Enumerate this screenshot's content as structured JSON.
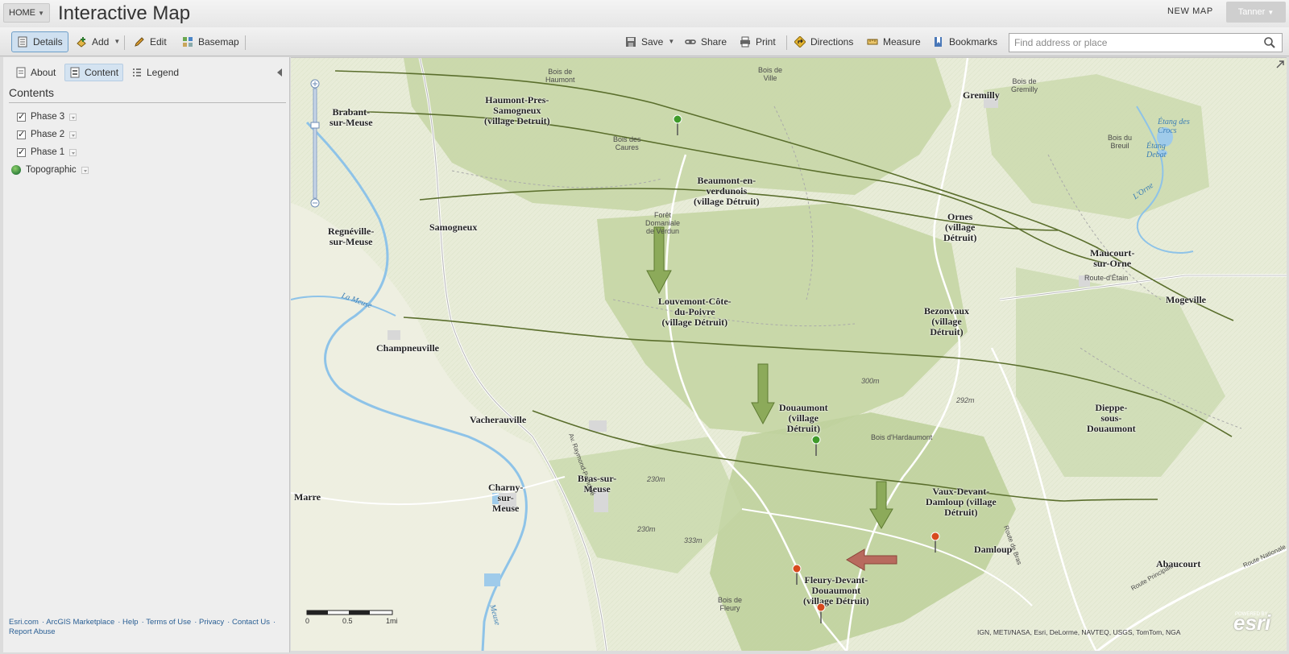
{
  "header": {
    "home_label": "HOME",
    "title": "Interactive Map",
    "new_map_label": "NEW MAP",
    "user_label": "Tanner"
  },
  "toolbar": {
    "details": "Details",
    "add": "Add",
    "edit": "Edit",
    "basemap": "Basemap",
    "save": "Save",
    "share": "Share",
    "print": "Print",
    "directions": "Directions",
    "measure": "Measure",
    "bookmarks": "Bookmarks",
    "search_placeholder": "Find address or place"
  },
  "panel": {
    "tabs": [
      "About",
      "Content",
      "Legend"
    ],
    "active_tab": "Content",
    "contents_title": "Contents",
    "layers": [
      {
        "name": "Phase 3",
        "checked": true
      },
      {
        "name": "Phase 2",
        "checked": true
      },
      {
        "name": "Phase 1",
        "checked": true
      }
    ],
    "basemap_layer": "Topographic",
    "footer_links": [
      "Esri.com",
      "ArcGIS Marketplace",
      "Help",
      "Terms of Use",
      "Privacy",
      "Contact Us",
      "Report Abuse"
    ]
  },
  "map": {
    "places": [
      "Brabant-\nsur-Meuse",
      "Haumont-Pres-\nSamogneux\n(village Detruit)",
      "Gremilly",
      "Beaumont-en-\nverdunois\n(village Détruit)",
      "Samogneux",
      "Regnéville-\nsur-Meuse",
      "Ornes\n(village\nDétruit)",
      "Maucourt-\nsur-Orne",
      "Mogeville",
      "Louvemont-Côte-\ndu-Poivre\n(village Détruit)",
      "Bezonvaux\n(village\nDétruit)",
      "Champneuville",
      "Douaumont\n(village\nDétruit)",
      "Dieppe-\nsous-\nDouaumont",
      "Vacherauville",
      "Bras-sur-\nMeuse",
      "Charny-\nsur-\nMeuse",
      "Marre",
      "Vaux-Devant-\nDamloup (village\nDétruit)",
      "Damloup",
      "Abaucourt",
      "Fleury-Devant-\nDouaumont\n(village Détruit)"
    ],
    "features": [
      "Bois de\nHaumont",
      "Bois de\nVille",
      "Bois de\nGremilly",
      "Bois des\nCaures",
      "Bois du\nBreuil",
      "Forêt\nDomaniale\nde Verdun",
      "Bois d'Hardaumont",
      "Bois de\nFleury",
      "Route-d'Étain"
    ],
    "water": [
      "Étang des\nCrocs",
      "Étang\nDebat",
      "L'Orne",
      "La Meuse",
      "Meuse"
    ],
    "contours": [
      "300m",
      "292m",
      "230m",
      "230m",
      "333m"
    ],
    "roads": [
      "Av. Raymond-Poincaré",
      "Route Principale",
      "Route Nationale",
      "Route de Bras"
    ],
    "scale": {
      "labels": [
        "0",
        "0.5",
        "1mi"
      ]
    },
    "attribution": "IGN, METI/NASA, Esri, DeLorme, NAVTEQ, USGS, TomTom, NGA",
    "logo": "esri",
    "powered_by": "POWERED BY",
    "colors": {
      "phase_lines": "#5a6e2c",
      "arrows_green": "#8caa5a",
      "arrow_red": "#b86a5e",
      "pin_green": "#3f9b2a",
      "pin_red": "#d74a1e"
    }
  }
}
